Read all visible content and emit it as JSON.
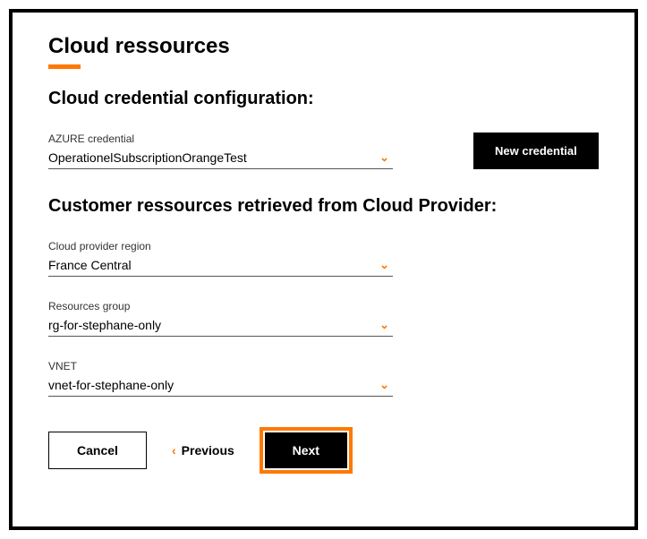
{
  "page_title": "Cloud ressources",
  "section1_heading": "Cloud credential configuration:",
  "credential": {
    "label": "AZURE credential",
    "value": "OperationelSubscriptionOrangeTest"
  },
  "new_credential_btn": "New credential",
  "section2_heading": "Customer ressources retrieved from Cloud Provider:",
  "region": {
    "label": "Cloud provider region",
    "value": "France Central"
  },
  "resource_group": {
    "label": "Resources group",
    "value": "rg-for-stephane-only"
  },
  "vnet": {
    "label": "VNET",
    "value": "vnet-for-stephane-only"
  },
  "footer": {
    "cancel": "Cancel",
    "previous": "Previous",
    "next": "Next"
  }
}
